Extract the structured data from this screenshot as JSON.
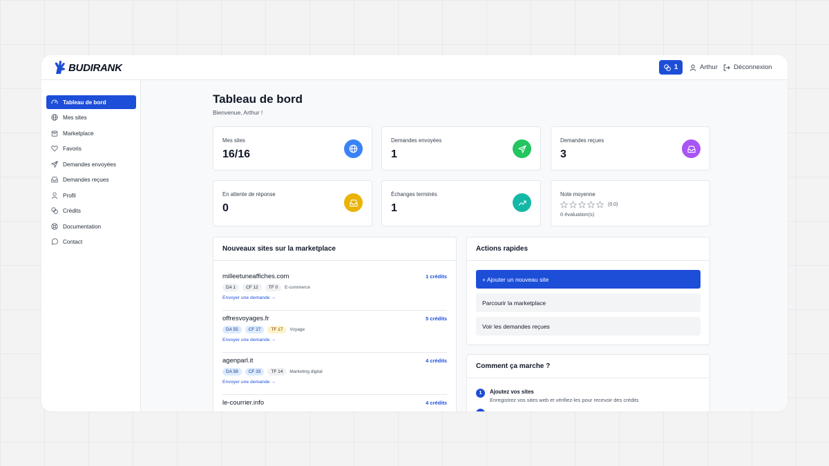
{
  "header": {
    "logo_text": "BUDIRANK",
    "credits_count": "1",
    "user_name": "Arthur",
    "logout_label": "Déconnexion"
  },
  "sidebar": {
    "items": [
      {
        "label": "Tableau de bord",
        "icon": "dashboard-gauge-icon",
        "active": true
      },
      {
        "label": "Mes sites",
        "icon": "globe-icon"
      },
      {
        "label": "Marketplace",
        "icon": "shopping-bag-icon"
      },
      {
        "label": "Favoris",
        "icon": "heart-icon"
      },
      {
        "label": "Demandes envoyées",
        "icon": "send-icon"
      },
      {
        "label": "Demandes reçues",
        "icon": "inbox-icon"
      },
      {
        "label": "Profil",
        "icon": "user-icon"
      },
      {
        "label": "Crédits",
        "icon": "coins-icon"
      },
      {
        "label": "Documentation",
        "icon": "lifebuoy-icon"
      },
      {
        "label": "Contact",
        "icon": "chat-bubble-icon"
      }
    ]
  },
  "page": {
    "title": "Tableau de bord",
    "welcome": "Bienvenue, Arthur !"
  },
  "stats": {
    "mes_sites": {
      "label": "Mes sites",
      "value": "16/16",
      "icon": "globe-icon",
      "color": "#3b82f6"
    },
    "envoyees": {
      "label": "Demandes envoyées",
      "value": "1",
      "icon": "send-icon",
      "color": "#22c55e"
    },
    "recues": {
      "label": "Demandes reçues",
      "value": "3",
      "icon": "inbox-icon",
      "color": "#a855f7"
    },
    "attente": {
      "label": "En attente de réponse",
      "value": "0",
      "icon": "inbox-icon",
      "color": "#eab308"
    },
    "termines": {
      "label": "Échanges terminés",
      "value": "1",
      "icon": "trending-up-icon",
      "color": "#14b8a6"
    },
    "note": {
      "label": "Note moyenne",
      "stars": 0,
      "rating_text": "(0.0)",
      "evaluations": "0 évaluation(s)"
    }
  },
  "marketplace": {
    "title": "Nouveaux sites sur la marketplace",
    "sites": [
      {
        "name": "milleetuneaffiches.com",
        "credits": "1 crédits",
        "da": "DA 1",
        "cf": "CF 12",
        "tf": "TF 0",
        "category": "E-commerce",
        "send": "Envoyer une demande →"
      },
      {
        "name": "offresvoyages.fr",
        "credits": "5 crédits",
        "da": "DA 55",
        "cf": "CF 27",
        "tf": "TF 17",
        "category": "Voyage",
        "send": "Envoyer une demande →"
      },
      {
        "name": "agenparl.it",
        "credits": "4 crédits",
        "da": "DA 58",
        "cf": "CF 33",
        "tf": "TF 14",
        "category": "Marketing digital",
        "send": "Envoyer une demande →"
      },
      {
        "name": "le-courrier.info",
        "credits": "4 crédits"
      }
    ]
  },
  "quick_actions": {
    "title": "Actions rapides",
    "add_site": "+ Ajouter un nouveau site",
    "browse": "Parcourir la marketplace",
    "view_requests": "Voir les demandes reçues"
  },
  "how_it_works": {
    "title": "Comment ça marche ?",
    "steps": [
      {
        "num": "1",
        "title": "Ajoutez vos sites",
        "desc": "Enregistrez vos sites web et vérifiez-les pour recevoir des crédits"
      }
    ]
  },
  "colors": {
    "accent": "#1d4ed8"
  }
}
